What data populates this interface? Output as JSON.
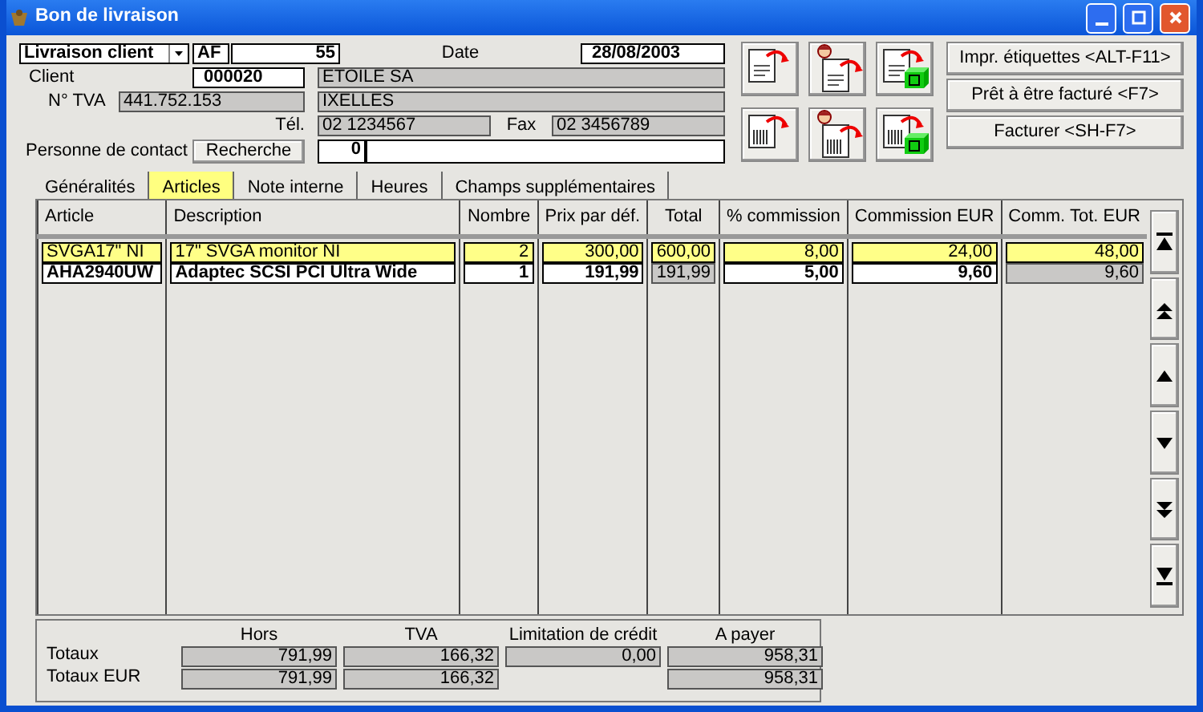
{
  "window": {
    "title": "Bon de livraison",
    "controls": [
      {
        "kind": "minimize"
      },
      {
        "kind": "maximize"
      },
      {
        "kind": "close"
      }
    ]
  },
  "header": {
    "doc_type": "Livraison client",
    "prefix": "AF",
    "number": "55",
    "date_label": "Date",
    "date": "28/08/2003",
    "client_label": "Client",
    "client_code": "000020",
    "client_name": "ETOILE SA",
    "vat_label": "N° TVA",
    "vat": "441.752.153",
    "city": "IXELLES",
    "tel_label": "Tél.",
    "tel": "02 1234567",
    "fax_label": "Fax",
    "fax": "02 3456789",
    "contact_label": "Personne de contact",
    "search_button": "Recherche",
    "contact_value": "0"
  },
  "tool_buttons": [
    {
      "kind": "document"
    },
    {
      "kind": "person"
    },
    {
      "kind": "box"
    },
    {
      "kind": "barcode"
    },
    {
      "kind": "person-barcode"
    },
    {
      "kind": "barcode-box"
    }
  ],
  "action_buttons": [
    "Impr. étiquettes <ALT-F11>",
    "Prêt à être facturé <F7>",
    "Facturer <SH-F7>"
  ],
  "tabs": [
    {
      "label": "Généralités",
      "selected": false
    },
    {
      "label": "Articles",
      "selected": true
    },
    {
      "label": "Note interne",
      "selected": false
    },
    {
      "label": "Heures",
      "selected": false
    },
    {
      "label": "Champs supplémentaires",
      "selected": false
    }
  ],
  "table": {
    "columns": [
      "Article",
      "Description",
      "Nombre",
      "Prix par déf.",
      "Total",
      "% commission",
      "Commission EUR",
      "Comm. Tot. EUR"
    ],
    "rows": [
      {
        "selected": true,
        "cells": [
          "SVGA17\" NI",
          "17\" SVGA monitor NI",
          "2",
          "300,00",
          "600,00",
          "8,00",
          "24,00",
          "48,00"
        ]
      },
      {
        "selected": false,
        "cells": [
          "AHA2940UW",
          "Adaptec SCSI PCI Ultra Wide",
          "1",
          "191,99",
          "191,99",
          "5,00",
          "9,60",
          "9,60"
        ]
      }
    ]
  },
  "scroll_buttons": [
    {
      "kind": "first"
    },
    {
      "kind": "page-up"
    },
    {
      "kind": "up"
    },
    {
      "kind": "down"
    },
    {
      "kind": "page-down"
    },
    {
      "kind": "last"
    }
  ],
  "totals": {
    "columns": [
      "Hors",
      "TVA",
      "Limitation de crédit",
      "A payer"
    ],
    "rows": [
      {
        "label": "Totaux",
        "cells": [
          {
            "kind": "field",
            "value": "791,99"
          },
          {
            "kind": "field",
            "value": "166,32"
          },
          {
            "kind": "field",
            "value": "0,00"
          },
          {
            "kind": "field",
            "value": "958,31"
          }
        ]
      },
      {
        "label": "Totaux EUR",
        "cells": [
          {
            "kind": "field",
            "value": "791,99"
          },
          {
            "kind": "field",
            "value": "166,32"
          },
          {
            "kind": "blank"
          },
          {
            "kind": "field",
            "value": "958,31"
          }
        ]
      }
    ]
  }
}
